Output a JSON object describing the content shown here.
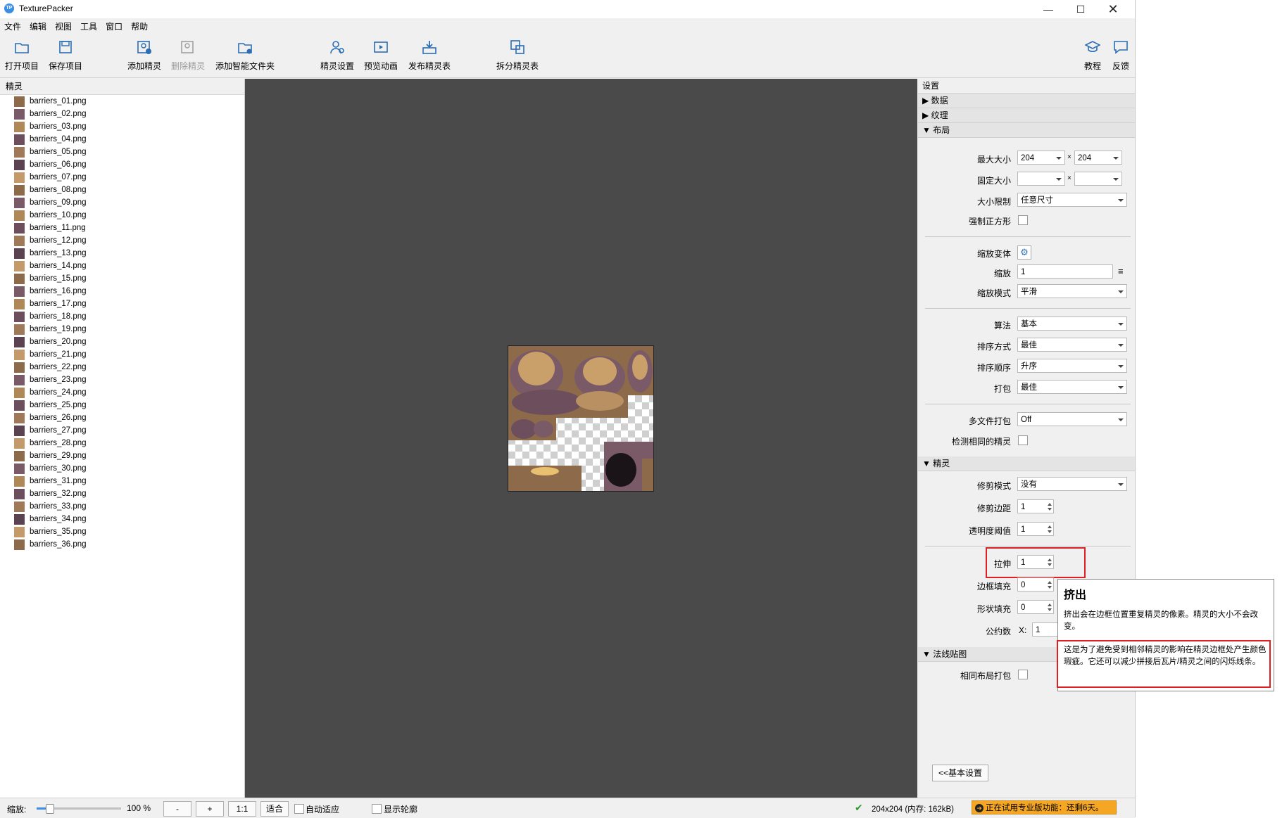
{
  "app": {
    "title": "TexturePacker"
  },
  "menu": [
    "文件",
    "编辑",
    "视图",
    "工具",
    "窗口",
    "帮助"
  ],
  "toolbar": {
    "open": "打开项目",
    "save": "保存项目",
    "add_sprites": "添加精灵",
    "remove_sprites": "删除精灵",
    "add_smart_folder": "添加智能文件夹",
    "sprite_settings": "精灵设置",
    "preview_anim": "预览动画",
    "publish": "发布精灵表",
    "split": "拆分精灵表",
    "tutorial": "教程",
    "feedback": "反馈"
  },
  "sprites_panel": {
    "header": "精灵",
    "items": [
      "barriers_01.png",
      "barriers_02.png",
      "barriers_03.png",
      "barriers_04.png",
      "barriers_05.png",
      "barriers_06.png",
      "barriers_07.png",
      "barriers_08.png",
      "barriers_09.png",
      "barriers_10.png",
      "barriers_11.png",
      "barriers_12.png",
      "barriers_13.png",
      "barriers_14.png",
      "barriers_15.png",
      "barriers_16.png",
      "barriers_17.png",
      "barriers_18.png",
      "barriers_19.png",
      "barriers_20.png",
      "barriers_21.png",
      "barriers_22.png",
      "barriers_23.png",
      "barriers_24.png",
      "barriers_25.png",
      "barriers_26.png",
      "barriers_27.png",
      "barriers_28.png",
      "barriers_29.png",
      "barriers_30.png",
      "barriers_31.png",
      "barriers_32.png",
      "barriers_33.png",
      "barriers_34.png",
      "barriers_35.png",
      "barriers_36.png"
    ]
  },
  "settings": {
    "header": "设置",
    "sections": {
      "data": "数据",
      "texture": "纹理",
      "layout": "布局",
      "sprites": "精灵",
      "normal_map": "法线贴图"
    },
    "max_size": {
      "label": "最大大小",
      "w": "204",
      "h": "204"
    },
    "fixed_size": {
      "label": "固定大小",
      "w": "",
      "h": ""
    },
    "size_constraints": {
      "label": "大小限制",
      "value": "任意尺寸"
    },
    "force_squared": {
      "label": "强制正方形"
    },
    "scale_variants": {
      "label": "缩放变体"
    },
    "scale": {
      "label": "缩放",
      "value": "1"
    },
    "scale_mode": {
      "label": "缩放模式",
      "value": "平滑"
    },
    "algorithm": {
      "label": "算法",
      "value": "基本"
    },
    "sort_by": {
      "label": "排序方式",
      "value": "最佳"
    },
    "sort_order": {
      "label": "排序顺序",
      "value": "升序"
    },
    "pack": {
      "label": "打包",
      "value": "最佳"
    },
    "multipack": {
      "label": "多文件打包",
      "value": "Off"
    },
    "detect_identical": {
      "label": "检测相同的精灵"
    },
    "trim_mode": {
      "label": "修剪模式",
      "value": "没有"
    },
    "trim_margin": {
      "label": "修剪边距",
      "value": "1"
    },
    "alpha_threshold": {
      "label": "透明度阈值",
      "value": "1"
    },
    "extrude": {
      "label": "拉伸",
      "value": "1"
    },
    "border_padding": {
      "label": "边框填充",
      "value": "0"
    },
    "shape_padding": {
      "label": "形状填充",
      "value": "0"
    },
    "common_divisor": {
      "label": "公约数",
      "x_label": "X:",
      "value": "1"
    },
    "pack_same_layout": {
      "label": "相同布局打包"
    },
    "basic_settings_btn": "<<基本设置"
  },
  "tooltip": {
    "title": "挤出",
    "line1": "挤出会在边框位置重复精灵的像素。精灵的大小不会改变。",
    "line2": "这是为了避免受到相邻精灵的影响在精灵边框处产生颜色瑕疵。它还可以减少拼接后瓦片/精灵之间的闪烁线条。"
  },
  "statusbar": {
    "zoom_label": "缩放:",
    "zoom_value": "100 %",
    "zoom_fraction": 0.15,
    "minus": "-",
    "plus": "+",
    "one_to_one": "1:1",
    "fit": "适合",
    "auto_fit": "自动适应",
    "show_outlines": "显示轮廓",
    "info": "204x204 (内存: 162kB)",
    "trial": "正在试用专业版功能：还剩6天。"
  },
  "colors": {
    "accent_blue": "#3a8ee6",
    "highlight_red": "#e02020",
    "trial_orange": "#f5a623",
    "canvas": "#4a4a4a"
  }
}
